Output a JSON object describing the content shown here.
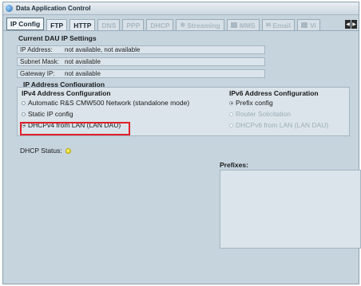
{
  "window": {
    "title": "Data Application Control"
  },
  "tabs": [
    {
      "label": "IP Config",
      "state": "active",
      "icon": ""
    },
    {
      "label": "FTP",
      "state": "enabled",
      "icon": ""
    },
    {
      "label": "HTTP",
      "state": "enabled",
      "icon": ""
    },
    {
      "label": "DNS",
      "state": "disabled",
      "icon": ""
    },
    {
      "label": "PPP",
      "state": "disabled",
      "icon": ""
    },
    {
      "label": "DHCP",
      "state": "disabled",
      "icon": ""
    },
    {
      "label": "Streaming",
      "state": "disabled",
      "icon": "snowflake-icon"
    },
    {
      "label": "MMS",
      "state": "disabled",
      "icon": "square-icon"
    },
    {
      "label": "Email",
      "state": "disabled",
      "icon": "mail-icon"
    },
    {
      "label": "Vi",
      "state": "disabled",
      "icon": "square-icon"
    }
  ],
  "current_settings": {
    "title": "Current DAU IP Settings",
    "rows": [
      {
        "label": "IP Address:",
        "value": "not available, not available"
      },
      {
        "label": "Subnet Mask:",
        "value": "not available"
      },
      {
        "label": "Gateway IP:",
        "value": "not available"
      }
    ]
  },
  "ip_config": {
    "title": "IP Address Configuration",
    "ipv4": {
      "title": "IPv4 Address Configuration",
      "options": [
        {
          "label": "Automatic R&S CMW500 Network (standalone mode)",
          "selected": false
        },
        {
          "label": "Static IP config",
          "selected": false
        },
        {
          "label": "DHCPv4 from LAN (LAN DAU)",
          "selected": true
        }
      ]
    },
    "ipv6": {
      "title": "IPv6 Address Configuration",
      "options": [
        {
          "label": "Prefix config",
          "selected": true,
          "enabled": true
        },
        {
          "label": "Router Solicitation",
          "selected": false,
          "enabled": false
        },
        {
          "label": "DHCPv6 from LAN (LAN DAU)",
          "selected": false,
          "enabled": false
        }
      ]
    }
  },
  "dhcp_status": {
    "label": "DHCP Status:",
    "indicator_color": "#e8d900"
  },
  "prefixes": {
    "label": "Prefixes:"
  },
  "colors": {
    "highlight": "#e0202a",
    "panel_bg": "#c6d4de",
    "field_bg": "#dae4ea"
  }
}
